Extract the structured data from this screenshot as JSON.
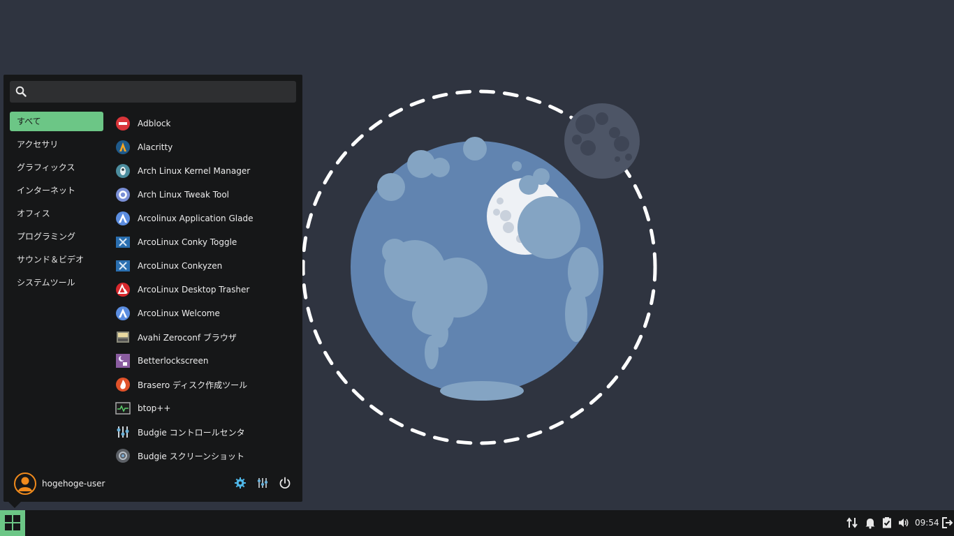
{
  "search": {
    "placeholder": ""
  },
  "categories": [
    {
      "label": "すべて",
      "active": true
    },
    {
      "label": "アクセサリ"
    },
    {
      "label": "グラフィックス"
    },
    {
      "label": "インターネット"
    },
    {
      "label": "オフィス"
    },
    {
      "label": "プログラミング"
    },
    {
      "label": "サウンド＆ビデオ"
    },
    {
      "label": "システムツール"
    }
  ],
  "apps": [
    {
      "label": "Adblock",
      "icon": "adblock-icon"
    },
    {
      "label": "Alacritty",
      "icon": "alacritty-icon"
    },
    {
      "label": "Arch Linux Kernel Manager",
      "icon": "kernel-manager-icon"
    },
    {
      "label": "Arch Linux Tweak Tool",
      "icon": "tweak-tool-icon"
    },
    {
      "label": "Arcolinux Application Glade",
      "icon": "arcolinux-glade-icon"
    },
    {
      "label": "ArcoLinux Conky Toggle",
      "icon": "conky-toggle-icon"
    },
    {
      "label": "ArcoLinux Conkyzen",
      "icon": "conkyzen-icon"
    },
    {
      "label": "ArcoLinux Desktop Trasher",
      "icon": "desktop-trasher-icon"
    },
    {
      "label": "ArcoLinux Welcome",
      "icon": "arcolinux-welcome-icon"
    },
    {
      "label": "Avahi Zeroconf ブラウザ",
      "icon": "avahi-icon"
    },
    {
      "label": "Betterlockscreen",
      "icon": "lockscreen-icon"
    },
    {
      "label": "Brasero ディスク作成ツール",
      "icon": "brasero-icon"
    },
    {
      "label": "btop++",
      "icon": "btop-icon"
    },
    {
      "label": "Budgie コントロールセンタ",
      "icon": "budgie-control-icon"
    },
    {
      "label": "Budgie スクリーンショット",
      "icon": "budgie-screenshot-icon"
    }
  ],
  "user": {
    "name": "hogehoge-user"
  },
  "footer_icons": [
    "settings-gear-icon",
    "control-sliders-icon",
    "power-icon"
  ],
  "tray_icons": [
    "network-updown-icon",
    "notification-bell-icon",
    "clipboard-check-icon",
    "volume-icon",
    "logout-icon"
  ],
  "clock": "09:54",
  "colors": {
    "accent": "#6cc686",
    "panel": "#161718",
    "desktop": "#2f3440"
  }
}
